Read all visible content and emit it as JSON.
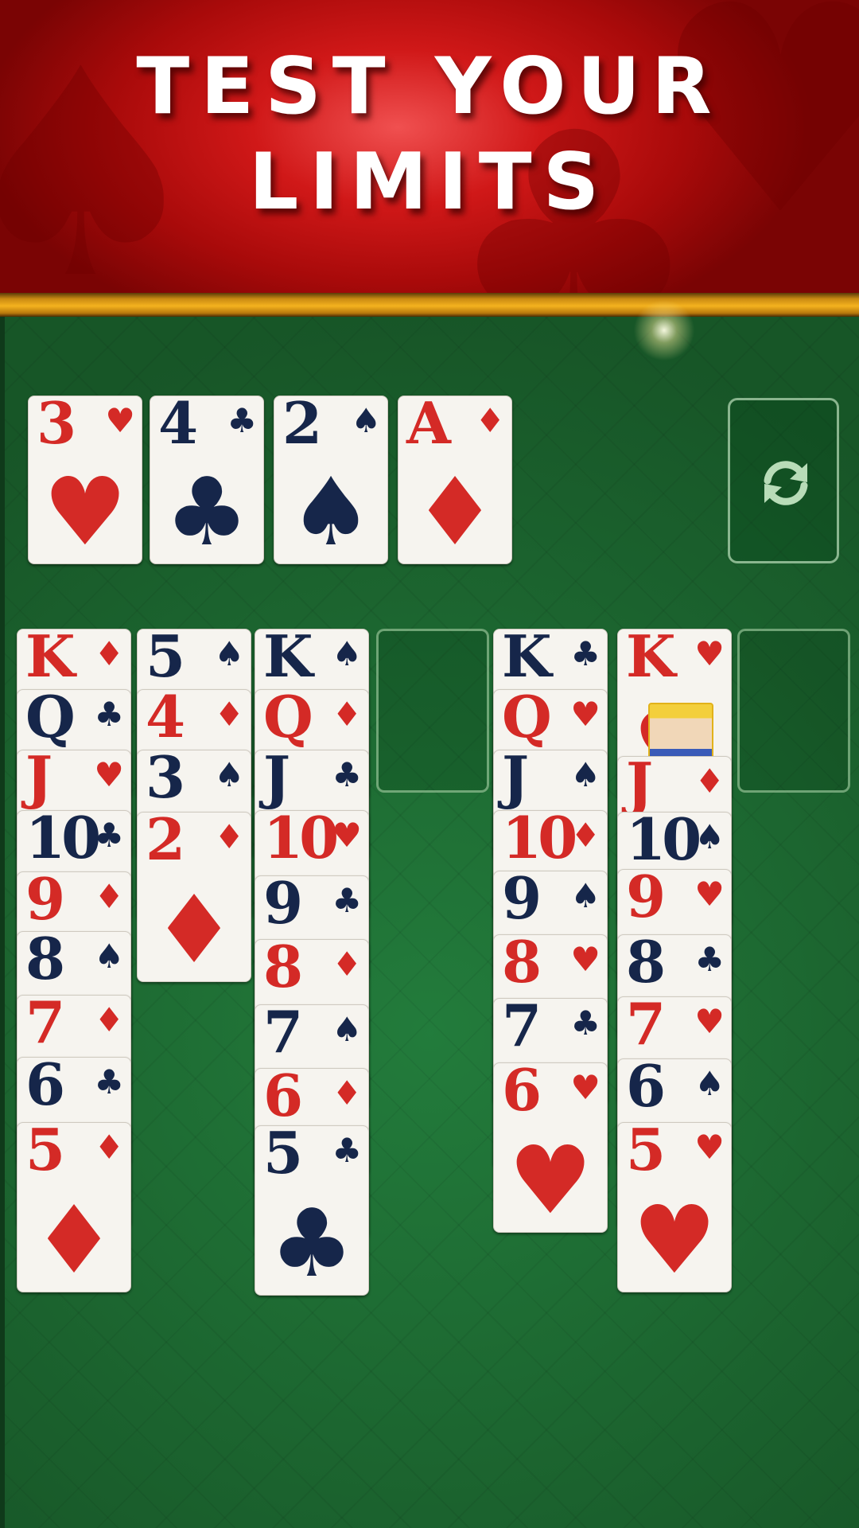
{
  "banner": {
    "line1": "TEST YOUR",
    "line2": "LIMITS"
  },
  "colors": {
    "red_suit": "#d42a26",
    "black_suit": "#16264a",
    "felt": "#1d6b31",
    "banner": "#c81414",
    "gold": "#f4b21e"
  },
  "controls": {
    "refresh_icon": "refresh-icon"
  },
  "foundations": [
    {
      "rank": "3",
      "suit": "♥",
      "color": "red"
    },
    {
      "rank": "4",
      "suit": "♣",
      "color": "black"
    },
    {
      "rank": "2",
      "suit": "♠",
      "color": "black"
    },
    {
      "rank": "A",
      "suit": "♦",
      "color": "red"
    }
  ],
  "tableau": [
    {
      "cards": [
        {
          "rank": "K",
          "suit": "♦",
          "color": "red"
        },
        {
          "rank": "Q",
          "suit": "♣",
          "color": "black"
        },
        {
          "rank": "J",
          "suit": "♥",
          "color": "red"
        },
        {
          "rank": "10",
          "suit": "♣",
          "color": "black"
        },
        {
          "rank": "9",
          "suit": "♦",
          "color": "red"
        },
        {
          "rank": "8",
          "suit": "♠",
          "color": "black"
        },
        {
          "rank": "7",
          "suit": "♦",
          "color": "red"
        },
        {
          "rank": "6",
          "suit": "♣",
          "color": "black"
        },
        {
          "rank": "5",
          "suit": "♦",
          "color": "red"
        }
      ]
    },
    {
      "cards": [
        {
          "rank": "5",
          "suit": "♠",
          "color": "black"
        },
        {
          "rank": "4",
          "suit": "♦",
          "color": "red"
        },
        {
          "rank": "3",
          "suit": "♠",
          "color": "black"
        },
        {
          "rank": "2",
          "suit": "♦",
          "color": "red"
        }
      ]
    },
    {
      "cards": [
        {
          "rank": "K",
          "suit": "♠",
          "color": "black"
        },
        {
          "rank": "Q",
          "suit": "♦",
          "color": "red"
        },
        {
          "rank": "J",
          "suit": "♣",
          "color": "black"
        },
        {
          "rank": "10",
          "suit": "♥",
          "color": "red"
        },
        {
          "rank": "9",
          "suit": "♣",
          "color": "black"
        },
        {
          "rank": "8",
          "suit": "♦",
          "color": "red"
        },
        {
          "rank": "7",
          "suit": "♠",
          "color": "black"
        },
        {
          "rank": "6",
          "suit": "♦",
          "color": "red"
        },
        {
          "rank": "5",
          "suit": "♣",
          "color": "black"
        }
      ]
    },
    {
      "cards": []
    },
    {
      "cards": [
        {
          "rank": "K",
          "suit": "♣",
          "color": "black"
        },
        {
          "rank": "Q",
          "suit": "♥",
          "color": "red"
        },
        {
          "rank": "J",
          "suit": "♠",
          "color": "black"
        },
        {
          "rank": "10",
          "suit": "♦",
          "color": "red"
        },
        {
          "rank": "9",
          "suit": "♠",
          "color": "black"
        },
        {
          "rank": "8",
          "suit": "♥",
          "color": "red"
        },
        {
          "rank": "7",
          "suit": "♣",
          "color": "black"
        },
        {
          "rank": "6",
          "suit": "♥",
          "color": "red"
        }
      ]
    },
    {
      "cards": [
        {
          "rank": "K",
          "suit": "♥",
          "color": "red",
          "face": true
        },
        {
          "rank": "J",
          "suit": "♦",
          "color": "red"
        },
        {
          "rank": "10",
          "suit": "♠",
          "color": "black"
        },
        {
          "rank": "9",
          "suit": "♥",
          "color": "red"
        },
        {
          "rank": "8",
          "suit": "♣",
          "color": "black"
        },
        {
          "rank": "7",
          "suit": "♥",
          "color": "red"
        },
        {
          "rank": "6",
          "suit": "♠",
          "color": "black"
        },
        {
          "rank": "5",
          "suit": "♥",
          "color": "red"
        }
      ]
    },
    {
      "cards": []
    }
  ]
}
